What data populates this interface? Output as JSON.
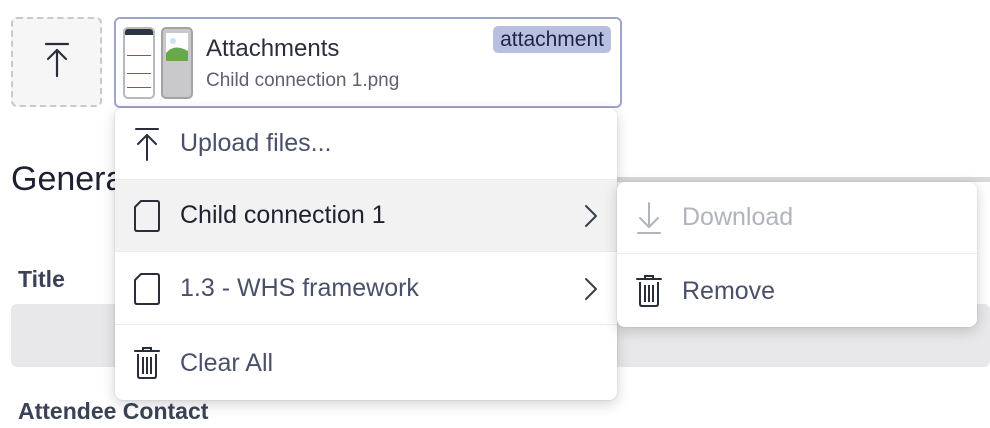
{
  "attachments": {
    "title": "Attachments",
    "filename": "Child connection 1.png",
    "badge": "attachment"
  },
  "form": {
    "section_title": "General",
    "title_label": "Title",
    "attendee_label": "Attendee Contact"
  },
  "menu": {
    "upload_label": "Upload files...",
    "items": [
      {
        "label": "Child connection 1"
      },
      {
        "label": "1.3 - WHS framework"
      }
    ],
    "clear_all_label": "Clear All"
  },
  "submenu": {
    "download_label": "Download",
    "remove_label": "Remove"
  },
  "icons": {
    "upload": "upload-icon",
    "document": "document-icon",
    "trash": "trash-icon",
    "chevron": "chevron-right-icon",
    "download": "download-icon"
  },
  "colors": {
    "badge_bg": "#b8c0df",
    "card_border": "#9ea6d0",
    "active_row": "#f2f2f3",
    "disabled_text": "#b2b4bd"
  }
}
